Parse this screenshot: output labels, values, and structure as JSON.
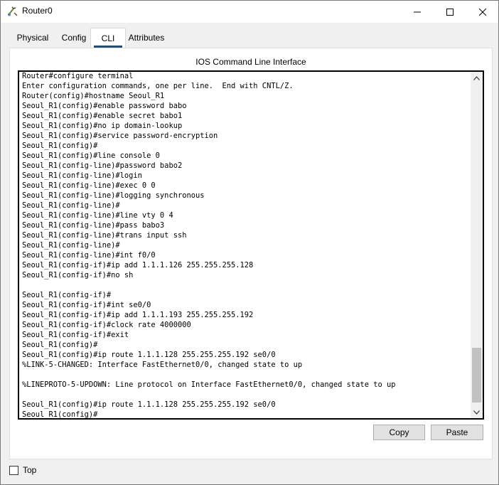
{
  "window": {
    "title": "Router0"
  },
  "tabs": [
    {
      "label": "Physical",
      "active": false
    },
    {
      "label": "Config",
      "active": false
    },
    {
      "label": "CLI",
      "active": true
    },
    {
      "label": "Attributes",
      "active": false
    }
  ],
  "cli": {
    "heading": "IOS Command Line Interface",
    "lines": [
      "Router#configure terminal",
      "Enter configuration commands, one per line.  End with CNTL/Z.",
      "Router(config)#hostname Seoul_R1",
      "Seoul_R1(config)#enable password babo",
      "Seoul_R1(config)#enable secret babo1",
      "Seoul_R1(config)#no ip domain-lookup",
      "Seoul_R1(config)#service password-encryption",
      "Seoul_R1(config)#",
      "Seoul_R1(config)#line console 0",
      "Seoul_R1(config-line)#password babo2",
      "Seoul_R1(config-line)#login",
      "Seoul_R1(config-line)#exec 0 0",
      "Seoul_R1(config-line)#logging synchronous",
      "Seoul_R1(config-line)#",
      "Seoul_R1(config-line)#line vty 0 4",
      "Seoul_R1(config-line)#pass babo3",
      "Seoul_R1(config-line)#trans input ssh",
      "Seoul_R1(config-line)#",
      "Seoul_R1(config-line)#int f0/0",
      "Seoul_R1(config-if)#ip add 1.1.1.126 255.255.255.128",
      "Seoul_R1(config-if)#no sh",
      "",
      "Seoul_R1(config-if)#",
      "Seoul_R1(config-if)#int se0/0",
      "Seoul_R1(config-if)#ip add 1.1.1.193 255.255.255.192",
      "Seoul_R1(config-if)#clock rate 4000000",
      "Seoul_R1(config-if)#exit",
      "Seoul_R1(config)#",
      "Seoul_R1(config)#ip route 1.1.1.128 255.255.255.192 se0/0",
      "%LINK-5-CHANGED: Interface FastEthernet0/0, changed state to up",
      "",
      "%LINEPROTO-5-UPDOWN: Line protocol on Interface FastEthernet0/0, changed state to up",
      "",
      "Seoul_R1(config)#ip route 1.1.1.128 255.255.255.192 se0/0",
      "Seoul_R1(config)#"
    ]
  },
  "buttons": {
    "copy": "Copy",
    "paste": "Paste"
  },
  "top_checkbox": {
    "label": "Top",
    "checked": false
  },
  "colors": {
    "active_tab_indicator": "#1f4e79",
    "titlebar_bg": "#ffffff",
    "window_bg": "#f0f0f0"
  }
}
